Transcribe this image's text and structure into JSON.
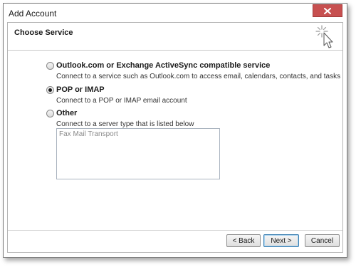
{
  "window": {
    "title": "Add Account"
  },
  "header": {
    "title": "Choose Service"
  },
  "options": [
    {
      "label": "Outlook.com or Exchange ActiveSync compatible service",
      "description": "Connect to a service such as Outlook.com to access email, calendars, contacts, and tasks",
      "selected": false
    },
    {
      "label": "POP or IMAP",
      "description": "Connect to a POP or IMAP email account",
      "selected": true
    },
    {
      "label": "Other",
      "description": "Connect to a server type that is listed below",
      "selected": false
    }
  ],
  "server_types": [
    "Fax Mail Transport"
  ],
  "buttons": {
    "back": "< Back",
    "next": "Next >",
    "cancel": "Cancel"
  },
  "colors": {
    "close_button": "#c75050",
    "default_button_border": "#3c7fb1"
  },
  "icons": {
    "close": "close-icon",
    "header": "cursor-sparkle-icon"
  }
}
